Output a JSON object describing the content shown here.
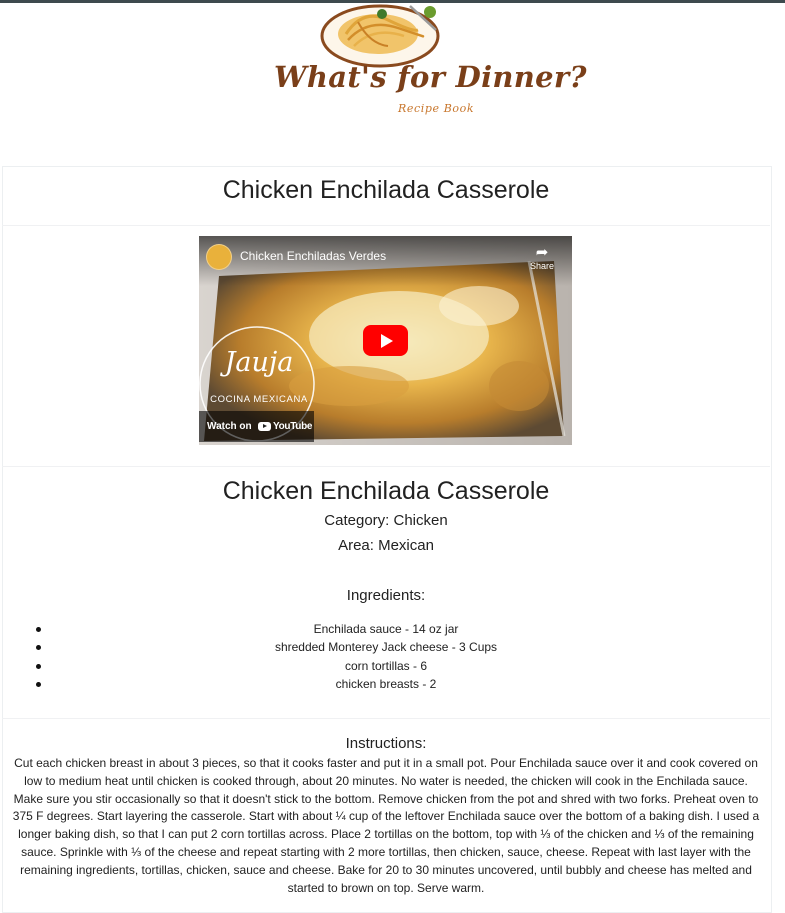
{
  "logo": {
    "title": "What's for Dinner?",
    "subtitle": "Recipe Book"
  },
  "header": {
    "recipe_title": "Chicken Enchilada Casserole"
  },
  "video": {
    "title": "Chicken Enchiladas Verdes",
    "share_label": "Share",
    "channel_brand": "Jauja",
    "channel_sub": "COCINA MEXICANA",
    "watch_on_label": "Watch on",
    "youtube_label": "YouTube"
  },
  "recipe": {
    "title": "Chicken Enchilada Casserole",
    "category_line": "Category: Chicken",
    "area_line": "Area: Mexican",
    "ingredients_heading": "Ingredients:",
    "ingredients": [
      "Enchilada sauce - 14 oz jar",
      "shredded Monterey Jack cheese - 3 Cups",
      "corn tortillas - 6",
      "chicken breasts - 2"
    ],
    "instructions_heading": "Instructions:",
    "instructions": "Cut each chicken breast in about 3 pieces, so that it cooks faster and put it in a small pot. Pour Enchilada sauce over it and cook covered on low to medium heat until chicken is cooked through, about 20 minutes. No water is needed, the chicken will cook in the Enchilada sauce. Make sure you stir occasionally so that it doesn't stick to the bottom. Remove chicken from the pot and shred with two forks. Preheat oven to 375 F degrees. Start layering the casserole. Start with about ¼ cup of the leftover Enchilada sauce over the bottom of a baking dish. I used a longer baking dish, so that I can put 2 corn tortillas across. Place 2 tortillas on the bottom, top with ⅓ of the chicken and ⅓ of the remaining sauce. Sprinkle with ⅓ of the cheese and repeat starting with 2 more tortillas, then chicken, sauce, cheese. Repeat with last layer with the remaining ingredients, tortillas, chicken, sauce and cheese. Bake for 20 to 30 minutes uncovered, until bubbly and cheese has melted and started to brown on top. Serve warm."
  },
  "colors": {
    "logo_brown": "#7a3f19",
    "logo_orange": "#c8762c",
    "youtube_red": "#ff0000",
    "top_strip": "#3e4a4e"
  }
}
